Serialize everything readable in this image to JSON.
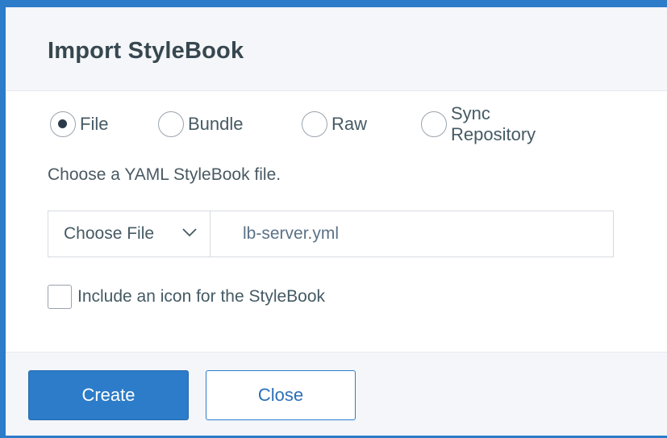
{
  "dialog": {
    "title": "Import StyleBook"
  },
  "source_options": {
    "selected": "File",
    "items": [
      {
        "label": "File",
        "checked": true
      },
      {
        "label": "Bundle",
        "checked": false
      },
      {
        "label": "Raw",
        "checked": false
      },
      {
        "label": "Sync Repository",
        "checked": false
      }
    ]
  },
  "helper_text": "Choose a YAML StyleBook file.",
  "file_picker": {
    "button_label": "Choose File",
    "icon": "chevron-down-icon",
    "file_name": "lb-server.yml"
  },
  "icon_option": {
    "label": "Include an icon for the StyleBook",
    "checked": false
  },
  "footer": {
    "create_label": "Create",
    "close_label": "Close"
  },
  "colors": {
    "accent": "#2c7cc9",
    "header_bg": "#f4f6f9",
    "title_text": "#37474f"
  }
}
